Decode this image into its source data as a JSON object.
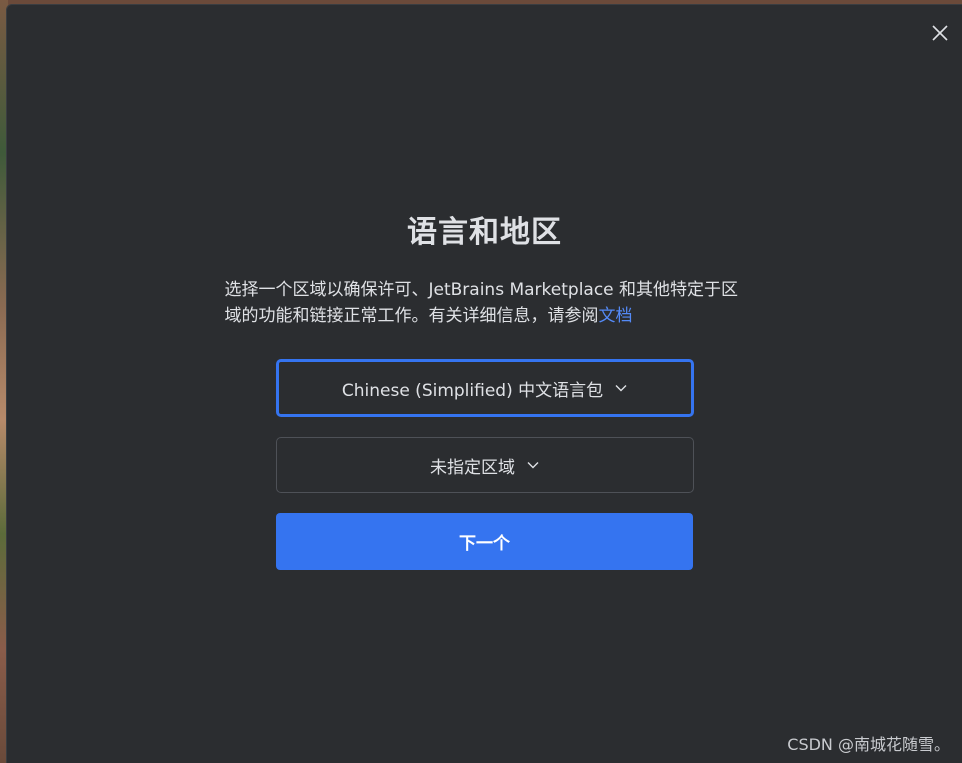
{
  "dialog": {
    "title": "语言和地区",
    "description_text": "选择一个区域以确保许可、JetBrains Marketplace 和其他特定于区域的功能和链接正常工作。有关详细信息，请参阅",
    "description_link": "文档",
    "language_select": {
      "value": "Chinese (Simplified) 中文语言包",
      "icon": "chevron-down-icon"
    },
    "region_select": {
      "value": "未指定区域",
      "icon": "chevron-down-icon"
    },
    "next_button": "下一个",
    "close_icon": "close-icon"
  },
  "watermark": "CSDN @南城花随雪。",
  "colors": {
    "background": "#2b2d30",
    "accent": "#3574f0",
    "link": "#548af7",
    "text": "#dfe1e5",
    "border": "#4e5157"
  }
}
